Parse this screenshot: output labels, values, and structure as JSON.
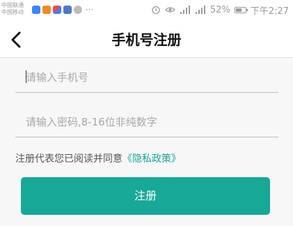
{
  "status_bar": {
    "carrier": "中国联通\n中国移动",
    "signal": "⁴⁶",
    "battery_text": "52%",
    "battery_level": 0.52,
    "time": "下午2:27"
  },
  "header": {
    "title": "手机号注册"
  },
  "form": {
    "phone_placeholder": "请输入手机号",
    "password_placeholder": "请输入密码,8-16位非纯数字"
  },
  "agreement": {
    "prefix": "注册代表您已阅读并同意",
    "link": "《隐私政策》"
  },
  "register_button": {
    "label": "注册"
  },
  "colors": {
    "accent": "#17a898",
    "link": "#1aa59a"
  }
}
